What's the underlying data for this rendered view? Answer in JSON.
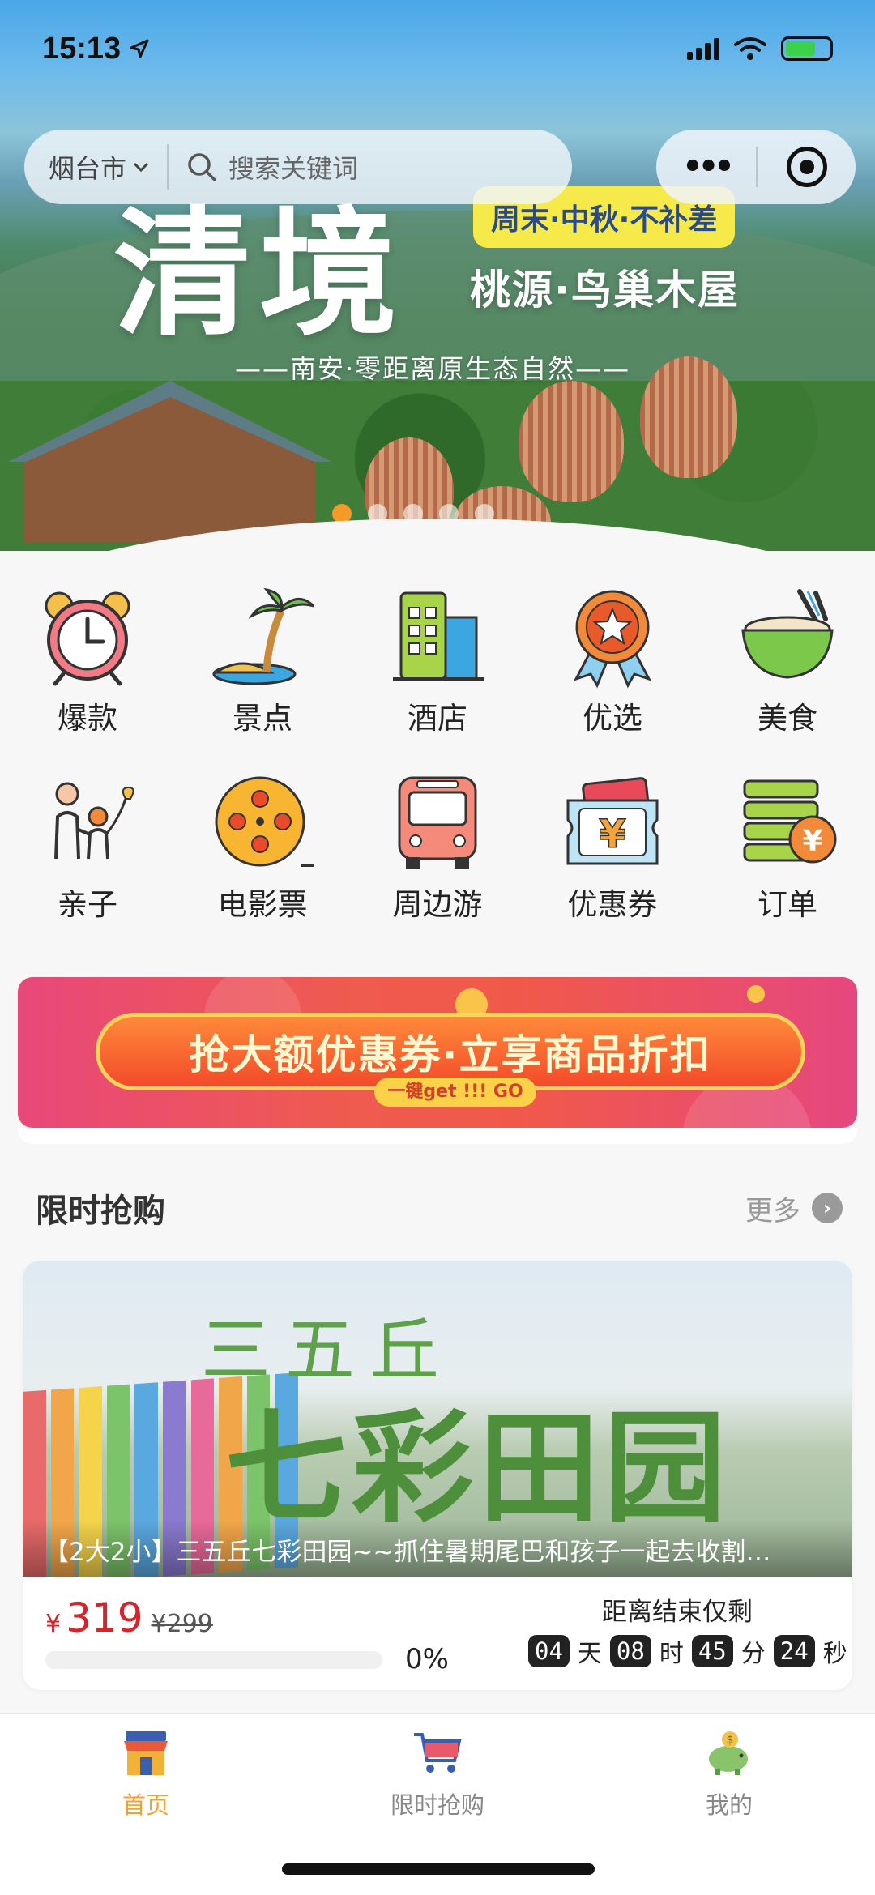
{
  "status": {
    "time": "15:13"
  },
  "search": {
    "city": "烟台市",
    "placeholder": "搜索关键词"
  },
  "banner": {
    "big_text": "清境",
    "tag": "周末·中秋·不补差",
    "title": "桃源·鸟巢木屋",
    "subtitle": "——南安·零距离原生态自然——",
    "slide_count": 5,
    "active_slide": 1
  },
  "categories": [
    {
      "label": "爆款",
      "icon": "alarm-clock-icon"
    },
    {
      "label": "景点",
      "icon": "palm-island-icon"
    },
    {
      "label": "酒店",
      "icon": "building-icon"
    },
    {
      "label": "优选",
      "icon": "medal-star-icon"
    },
    {
      "label": "美食",
      "icon": "food-bowl-icon"
    },
    {
      "label": "亲子",
      "icon": "family-icon"
    },
    {
      "label": "电影票",
      "icon": "film-reel-icon"
    },
    {
      "label": "周边游",
      "icon": "bus-icon"
    },
    {
      "label": "优惠券",
      "icon": "yen-ticket-icon"
    },
    {
      "label": "订单",
      "icon": "coin-stack-icon"
    }
  ],
  "coupon_banner": {
    "text": "抢大额优惠券·立享商品折扣",
    "button": "一键get !!! GO"
  },
  "flash_sale": {
    "title": "限时抢购",
    "more": "更多",
    "product": {
      "image_small_text": "三五丘",
      "image_big_text": "七彩田园",
      "caption": "【2大2小】三五丘七彩田园~~抓住暑期尾巴和孩子一起去收割…",
      "currency": "¥",
      "price": "319",
      "original_price": "¥299",
      "sold_percent": "0%",
      "sold_fraction": 0,
      "countdown_label": "距离结束仅剩",
      "countdown": {
        "days": "04",
        "days_unit": "天",
        "hours": "08",
        "hours_unit": "时",
        "minutes": "45",
        "minutes_unit": "分",
        "seconds": "24",
        "seconds_unit": "秒"
      }
    }
  },
  "tabbar": [
    {
      "label": "首页",
      "icon": "shop-icon",
      "active": true
    },
    {
      "label": "限时抢购",
      "icon": "cart-icon",
      "active": false
    },
    {
      "label": "我的",
      "icon": "piggy-bank-icon",
      "active": false
    }
  ],
  "colors": {
    "accent": "#f39a2a",
    "price": "#d8232a",
    "tab_active": "#f0a23a",
    "tab_inactive": "#888888"
  }
}
